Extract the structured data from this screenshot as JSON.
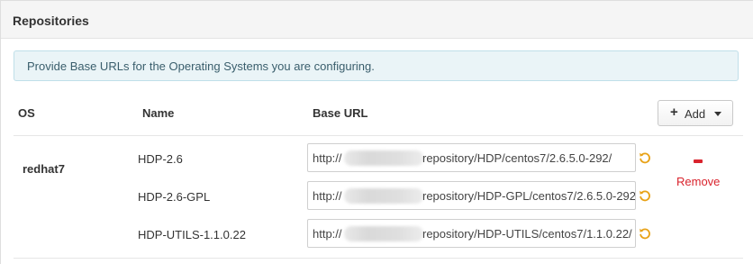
{
  "panel": {
    "title": "Repositories"
  },
  "alert": {
    "text": "Provide Base URLs for the Operating Systems you are configuring."
  },
  "table": {
    "headers": {
      "os": "OS",
      "name": "Name",
      "base_url": "Base URL"
    },
    "add_button": {
      "plus": "+",
      "label": "Add"
    },
    "os_group": {
      "os": "redhat7",
      "remove_label": "Remove",
      "repos": [
        {
          "name": "HDP-2.6",
          "url_prefix": "http://",
          "url_suffix": "repository/HDP/centos7/2.6.5.0-292/"
        },
        {
          "name": "HDP-2.6-GPL",
          "url_prefix": "http://",
          "url_suffix": "repository/HDP-GPL/centos7/2.6.5.0-292/"
        },
        {
          "name": "HDP-UTILS-1.1.0.22",
          "url_prefix": "http://",
          "url_suffix": "repository/HDP-UTILS/centos7/1.1.0.22/"
        }
      ]
    }
  },
  "colors": {
    "remove": "#d9232d",
    "undo": "#e8a217",
    "alert_bg": "#eaf4f7"
  },
  "icons": {
    "undo": "undo-icon",
    "remove": "minus-icon",
    "add": "plus-icon",
    "caret": "caret-down-icon"
  }
}
